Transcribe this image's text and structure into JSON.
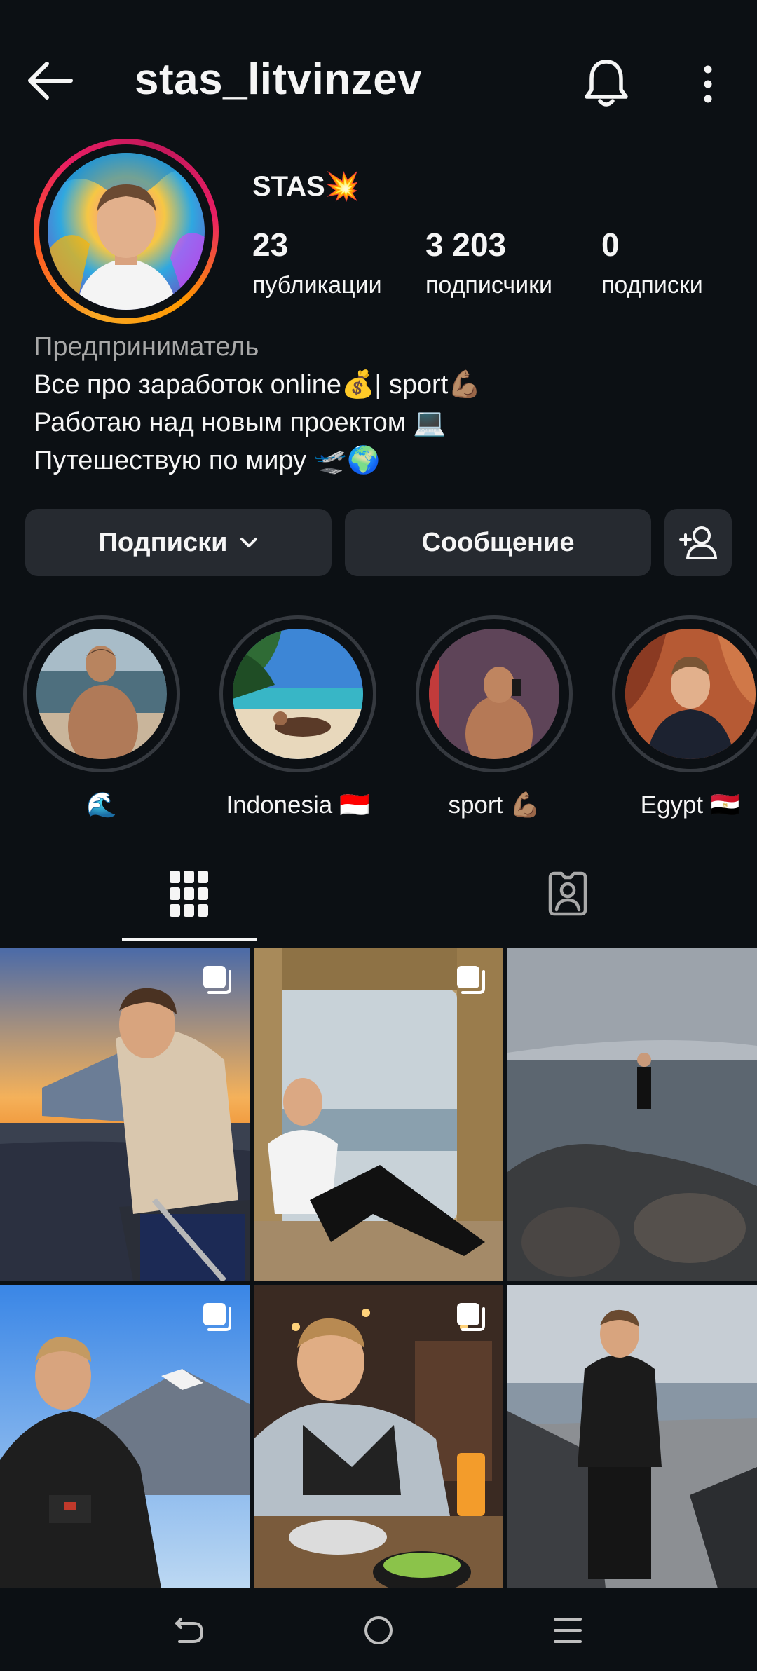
{
  "header": {
    "username": "stas_litvinzev",
    "back_icon": "arrow-left-icon",
    "bell_icon": "bell-icon",
    "more_icon": "more-vertical-icon"
  },
  "profile": {
    "display_name": "STAS💥",
    "stats": [
      {
        "value": "23",
        "label": "публикации"
      },
      {
        "value": "3 203",
        "label": "подписчики"
      },
      {
        "value": "0",
        "label": "подписки"
      }
    ],
    "bio": {
      "category": "Предприниматель",
      "lines": [
        "Все про заработок online💰| sport💪🏽",
        "Работаю над новым проектом 💻",
        "Путешествую по миру 🛫🌍"
      ]
    }
  },
  "actions": {
    "following_label": "Подписки",
    "message_label": "Сообщение"
  },
  "highlights": [
    {
      "label": "🌊"
    },
    {
      "label": "Indonesia 🇮🇩"
    },
    {
      "label": "sport 💪🏽"
    },
    {
      "label": "Egypt 🇪🇬"
    }
  ],
  "tabs": {
    "active": "grid",
    "items": [
      "grid-icon",
      "tagged-icon"
    ]
  },
  "colors": {
    "background": "#0c1014",
    "button": "#262a30",
    "secondary_text": "#a8a8a8",
    "ring_gradient": [
      "#f9a825",
      "#ff5722",
      "#e91e63"
    ]
  }
}
